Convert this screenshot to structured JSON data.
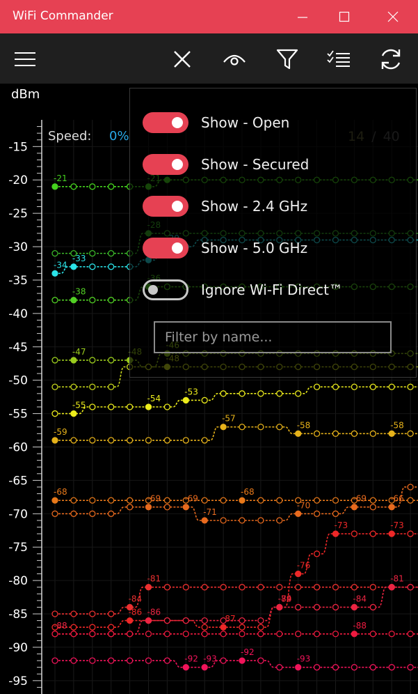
{
  "window": {
    "title": "WiFi Commander"
  },
  "toolbar": {
    "icons": [
      "hamburger-menu-icon",
      "close-icon",
      "eye-icon",
      "filter-icon",
      "checklist-icon",
      "refresh-icon"
    ]
  },
  "chart_data": {
    "type": "line",
    "ylabel": "dBm",
    "ylim": [
      -97,
      -11
    ],
    "y_ticks": [
      -15,
      -20,
      -25,
      -30,
      -35,
      -40,
      -45,
      -50,
      -55,
      -60,
      -65,
      -70,
      -75,
      -80,
      -85,
      -90,
      -95
    ],
    "samples": 23,
    "series": [
      {
        "color": "#45d21e",
        "values": [
          -21,
          -21,
          -21,
          -21,
          -21,
          -21,
          -20,
          -20,
          -20,
          -20,
          -20,
          -20,
          -20,
          -20,
          -20,
          -20,
          -20,
          -20,
          -20,
          -20,
          -20,
          -20,
          -20
        ],
        "labels": [
          [
            0,
            "-21"
          ],
          [
            5,
            "-21"
          ],
          [
            6,
            "-20"
          ]
        ]
      },
      {
        "color": "#3cbb2a",
        "values": [
          -31,
          -31,
          -31,
          -31,
          -31,
          -28,
          -28,
          -28,
          -28,
          -28,
          -28,
          -28,
          -28,
          -28,
          -28,
          -28,
          -28,
          -28,
          -28,
          -28,
          -28,
          -28,
          -28
        ],
        "labels": [
          [
            5,
            "-28"
          ]
        ]
      },
      {
        "color": "#2be3e8",
        "values": [
          -34,
          -33,
          -33,
          -33,
          -33,
          -32,
          -30,
          -30,
          -29,
          -29,
          -29,
          -29,
          -29,
          -29,
          -29,
          -29,
          -29,
          -29,
          -29,
          -29,
          -29,
          -29,
          -29
        ],
        "labels": [
          [
            0,
            "-34"
          ],
          [
            1,
            "-33"
          ],
          [
            5,
            "-32"
          ],
          [
            6,
            "-29"
          ]
        ]
      },
      {
        "color": "#52d024",
        "values": [
          -38,
          -38,
          -38,
          -38,
          -38,
          -36,
          -36,
          -36,
          -36,
          -36,
          -36,
          -36,
          -36,
          -36,
          -36,
          -36,
          -36,
          -36,
          -36,
          -36,
          -36,
          -36,
          -36
        ],
        "labels": [
          [
            1,
            "-38"
          ],
          [
            5,
            "-36"
          ]
        ]
      },
      {
        "color": "#9acc1e",
        "values": [
          -47,
          -47,
          -47,
          -47,
          -47,
          -48,
          -46,
          -46,
          -46,
          -46,
          -46,
          -46,
          -46,
          -46,
          -46,
          -46,
          -46,
          -46,
          -46,
          -46,
          -46,
          -46,
          -46
        ],
        "labels": [
          [
            1,
            "-47"
          ],
          [
            4,
            "-48"
          ],
          [
            6,
            "-46"
          ]
        ]
      },
      {
        "color": "#c8d81c",
        "values": [
          -51,
          -51,
          -51,
          -51,
          -48,
          -48,
          -48,
          -48,
          -48,
          -48,
          -48,
          -48,
          -48,
          -48,
          -48,
          -48,
          -48,
          -48,
          -48,
          -48,
          -48,
          -48,
          -48
        ],
        "labels": [
          [
            6,
            "-48"
          ]
        ]
      },
      {
        "color": "#ecec1c",
        "values": [
          -55,
          -55,
          -54,
          -54,
          -54,
          -54,
          -54,
          -53,
          -53,
          -52,
          -52,
          -52,
          -52,
          -52,
          -51,
          -51,
          -51,
          -51,
          -51,
          -51,
          -51,
          -51,
          -51
        ],
        "labels": [
          [
            1,
            "-55"
          ],
          [
            5,
            "-54"
          ],
          [
            7,
            "-53"
          ]
        ]
      },
      {
        "color": "#e6b21a",
        "values": [
          -59,
          -59,
          -59,
          -59,
          -59,
          -59,
          -59,
          -59,
          -59,
          -57,
          -57,
          -57,
          -57,
          -58,
          -58,
          -58,
          -58,
          -58,
          -58,
          -58,
          -58,
          -58,
          -58
        ],
        "labels": [
          [
            0,
            "-59"
          ],
          [
            9,
            "-57"
          ],
          [
            13,
            "-58"
          ],
          [
            18,
            "-58"
          ]
        ]
      },
      {
        "color": "#e8791a",
        "values": [
          -68,
          -68,
          -68,
          -68,
          -68,
          -68,
          -68,
          -68,
          -68,
          -68,
          -68,
          -68,
          -68,
          -68,
          -68,
          -68,
          -68,
          -68,
          -68,
          -68,
          -68,
          -68,
          -68
        ],
        "labels": [
          [
            0,
            "-68"
          ],
          [
            10,
            "-68"
          ]
        ]
      },
      {
        "color": "#e86a1e",
        "values": [
          -70,
          -70,
          -70,
          -70,
          -69,
          -69,
          -69,
          -69,
          -71,
          -71,
          -71,
          -71,
          -71,
          -70,
          -70,
          -70,
          -69,
          -69,
          -69,
          -66,
          -66,
          -66,
          -66
        ],
        "labels": [
          [
            5,
            "-69"
          ],
          [
            7,
            "-69"
          ],
          [
            8,
            "-71"
          ],
          [
            13,
            "-70"
          ],
          [
            16,
            "-69"
          ],
          [
            18,
            "-66"
          ]
        ]
      },
      {
        "color": "#ec3030",
        "values": [
          -85,
          -85,
          -85,
          -85,
          -84,
          -81,
          -81,
          -81,
          -81,
          -81,
          -81,
          -81,
          -81,
          -81,
          -81,
          -81,
          -81,
          -81,
          -81,
          -81,
          -81,
          -81,
          -81
        ],
        "labels": [
          [
            4,
            "-84"
          ],
          [
            5,
            "-81"
          ]
        ]
      },
      {
        "color": "#ee2828",
        "values": [
          -87,
          -87,
          -87,
          -87,
          -86,
          -86,
          -86,
          -86,
          -87,
          -87,
          -87,
          -87,
          -84,
          -79,
          -76,
          -73,
          -73,
          -73,
          -73,
          -73,
          -73,
          -73,
          -73
        ],
        "labels": [
          [
            4,
            "-86"
          ],
          [
            9,
            "-87"
          ],
          [
            12,
            "-79"
          ],
          [
            13,
            "-76"
          ],
          [
            15,
            "-73"
          ],
          [
            18,
            "-73"
          ]
        ]
      },
      {
        "color": "#ec2442",
        "values": [
          -88,
          -88,
          -88,
          -88,
          -88,
          -86,
          -86,
          -86,
          -86,
          -86,
          -86,
          -86,
          -84,
          -84,
          -84,
          -84,
          -84,
          -84,
          -81,
          -81,
          -81,
          -81,
          -81
        ],
        "labels": [
          [
            0,
            "-88"
          ],
          [
            5,
            "-86"
          ],
          [
            12,
            "-84"
          ],
          [
            16,
            "-84"
          ],
          [
            18,
            "-81"
          ]
        ]
      },
      {
        "color": "#f01a40",
        "values": [
          -88,
          -88,
          -88,
          -88,
          -88,
          -88,
          -88,
          -88,
          -88,
          -88,
          -88,
          -88,
          -88,
          -88,
          -88,
          -88,
          -88,
          -88,
          -88,
          -88,
          -88,
          -88,
          -88
        ],
        "labels": [
          [
            16,
            "-88"
          ]
        ]
      },
      {
        "color": "#f0145a",
        "values": [
          -92,
          -92,
          -92,
          -92,
          -92,
          -92,
          -92,
          -93,
          -93,
          -92,
          -92,
          -92,
          -93,
          -93,
          -93,
          -93,
          -93,
          -93,
          -93,
          -93,
          -93,
          -93,
          -93
        ],
        "labels": [
          [
            7,
            "-92"
          ],
          [
            8,
            "-93"
          ],
          [
            10,
            "-92"
          ],
          [
            13,
            "-93"
          ]
        ]
      }
    ]
  },
  "overlay": {
    "dbm_label": "dBm",
    "speed_label": "Speed:",
    "speed_value": "0%",
    "shown_count": "14",
    "separator": "/",
    "total_count": "40"
  },
  "settings": {
    "toggles": [
      {
        "label": "Show - Open",
        "on": true
      },
      {
        "label": "Show - Secured",
        "on": true
      },
      {
        "label": "Show - 2.4 GHz",
        "on": true
      },
      {
        "label": "Show - 5.0 GHz",
        "on": true
      },
      {
        "label": "Ignore Wi-Fi Direct™",
        "on": false
      }
    ],
    "filter_placeholder": "Filter by name..."
  },
  "colors": {
    "accent": "#e64153",
    "toolbar": "#1f1f1f",
    "background": "#000000"
  }
}
